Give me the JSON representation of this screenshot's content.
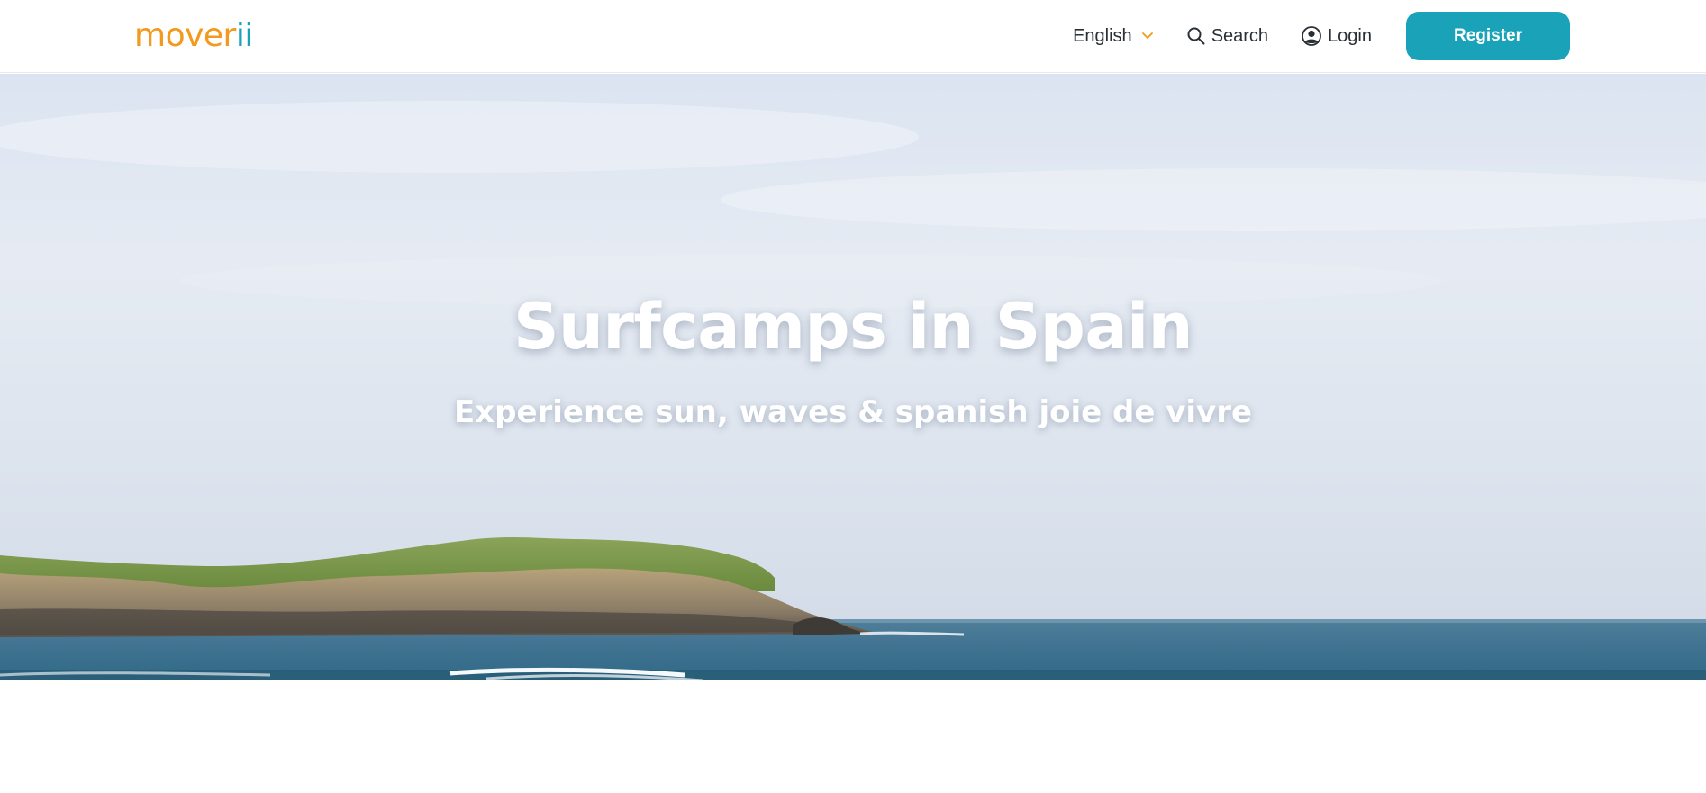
{
  "header": {
    "logo": {
      "text_main": "mover",
      "text_accent": "ii"
    },
    "language": {
      "label": "English"
    },
    "search": {
      "label": "Search"
    },
    "login": {
      "label": "Login"
    },
    "register": {
      "label": "Register"
    }
  },
  "hero": {
    "title": "Surfcamps in Spain",
    "subtitle": "Experience sun, waves & spanish joie de vivre"
  },
  "colors": {
    "brand_orange": "#f39a1e",
    "brand_teal": "#1aa3b8",
    "text_dark": "#2a2f36"
  },
  "icons": {
    "language": "chevron-down-icon",
    "search": "search-icon",
    "login": "user-circle-icon"
  }
}
